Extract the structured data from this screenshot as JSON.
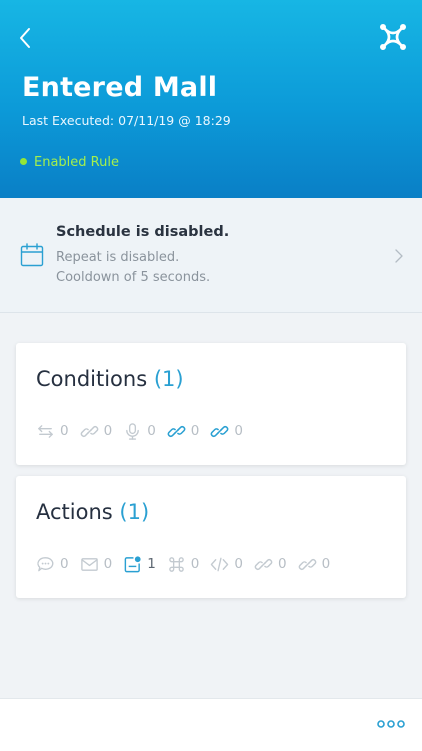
{
  "header": {
    "title": "Entered Mall",
    "last_executed": "Last Executed: 07/11/19 @ 18:29",
    "status_label": "Enabled Rule"
  },
  "schedule": {
    "title": "Schedule is disabled.",
    "repeat_text": "Repeat is disabled.",
    "cooldown_text": "Cooldown of 5 seconds."
  },
  "conditions": {
    "title": "Conditions",
    "count": "(1)",
    "items": [
      {
        "icon": "transfer-icon",
        "count": "0"
      },
      {
        "icon": "link-icon",
        "count": "0"
      },
      {
        "icon": "microphone-icon",
        "count": "0"
      },
      {
        "icon": "link-icon",
        "count": "0"
      },
      {
        "icon": "link-icon",
        "count": "0"
      }
    ]
  },
  "actions": {
    "title": "Actions",
    "count": "(1)",
    "items": [
      {
        "icon": "chat-bubble-icon",
        "count": "0"
      },
      {
        "icon": "mail-icon",
        "count": "0"
      },
      {
        "icon": "notification-icon",
        "count": "1"
      },
      {
        "icon": "command-icon",
        "count": "0"
      },
      {
        "icon": "code-icon",
        "count": "0"
      },
      {
        "icon": "link-icon",
        "count": "0"
      },
      {
        "icon": "link-icon",
        "count": "0"
      }
    ]
  },
  "colors": {
    "header_gradient_top": "#17b6e4",
    "header_gradient_bottom": "#0a7fc6",
    "status_green": "#a4ef4d",
    "accent": "#2aa0d2",
    "inactive_icon": "#c3cad0"
  }
}
